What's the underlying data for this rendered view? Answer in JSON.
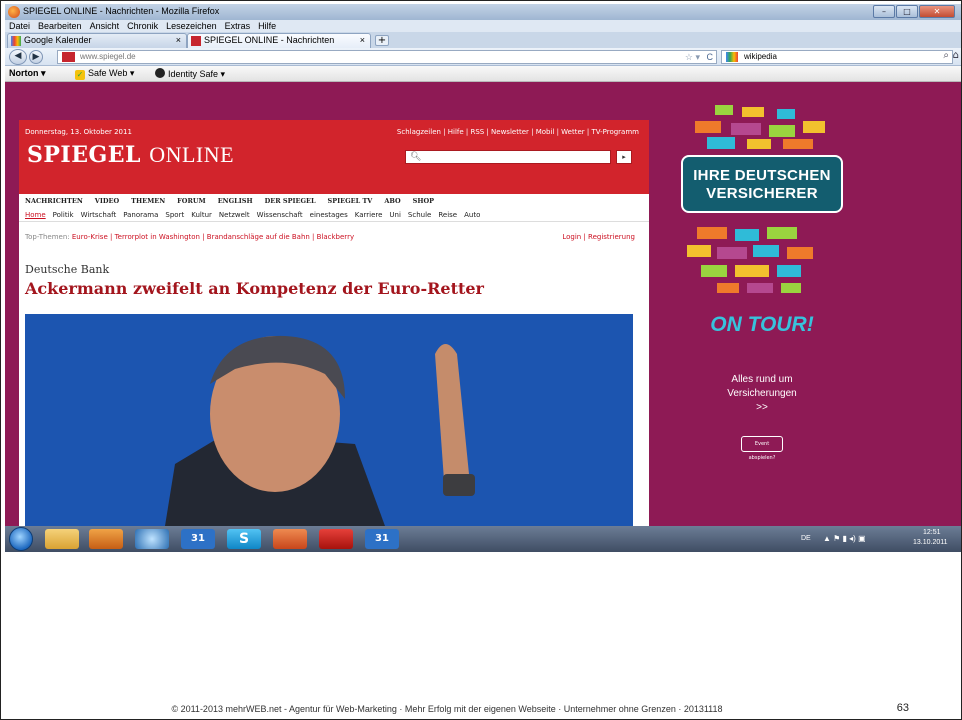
{
  "browser": {
    "window_title": "SPIEGEL ONLINE - Nachrichten - Mozilla Firefox",
    "menu": [
      "Datei",
      "Bearbeiten",
      "Ansicht",
      "Chronik",
      "Lesezeichen",
      "Extras",
      "Hilfe"
    ],
    "tabs": [
      {
        "label": "Google Kalender"
      },
      {
        "label": "SPIEGEL ONLINE - Nachrichten"
      }
    ],
    "url": "www.spiegel.de",
    "search_value": "wikipedia",
    "norton": {
      "brand": "Norton",
      "safe_web": "Safe Web",
      "identity_safe": "Identity Safe"
    }
  },
  "spiegel": {
    "date": "Donnerstag, 13. Oktober 2011",
    "toplinks": "Schlagzeilen | Hilfe | RSS | Newsletter | Mobil | Wetter | TV-Programm",
    "logo_bold": "SPIEGEL",
    "logo_light": "ONLINE",
    "nav_main": [
      "NACHRICHTEN",
      "VIDEO",
      "THEMEN",
      "FORUM",
      "ENGLISH",
      "DER SPIEGEL",
      "SPIEGEL TV",
      "ABO",
      "SHOP"
    ],
    "nav_sub": [
      "Home",
      "Politik",
      "Wirtschaft",
      "Panorama",
      "Sport",
      "Kultur",
      "Netzwelt",
      "Wissenschaft",
      "einestages",
      "Karriere",
      "Uni",
      "Schule",
      "Reise",
      "Auto"
    ],
    "topthemen_label": "Top-Themen:",
    "topthemen": "Euro-Krise | Terrorplot in Washington | Brandanschläge auf die Bahn | Blackberry",
    "login": "Login | Registrierung",
    "kicker": "Deutsche Bank",
    "headline": "Ackermann zweifelt an Kompetenz der Euro-Retter"
  },
  "ad": {
    "bubble": "IHRE DEUTSCHEN VERSICHERER",
    "ontour": "ON TOUR!",
    "text_line1": "Alles rund um",
    "text_line2": "Versicherungen",
    "text_line3": ">>",
    "button": "Event abspielen?"
  },
  "taskbar": {
    "language": "DE",
    "time": "12:51",
    "date": "13.10.2011",
    "calendar_day": "31"
  },
  "footer": {
    "text": "© 2011-2013  mehrWEB.net - Agentur für Web-Marketing   ·  Mehr Erfolg mit der eigenen Webseite   ·  Unternehmer ohne Grenzen   ·  20131118",
    "page_number": "63"
  },
  "colors": {
    "spiegel_red": "#d2242c",
    "headline_red": "#a3151d",
    "ad_purple": "#8e1a55",
    "ad_teal": "#135d6f"
  }
}
